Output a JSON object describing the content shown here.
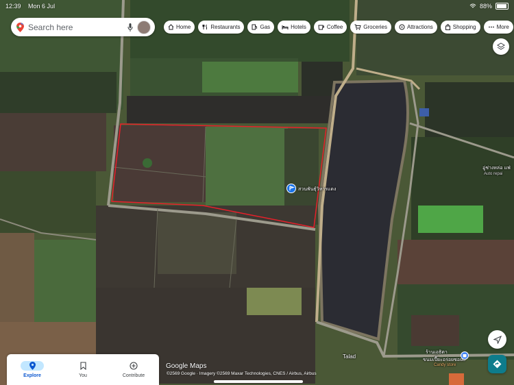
{
  "status_bar": {
    "time": "12:39",
    "date": "Mon 6 Jul",
    "battery": "88%"
  },
  "search": {
    "placeholder": "Search here"
  },
  "chips": [
    {
      "label": "Home",
      "icon": "home-icon"
    },
    {
      "label": "Restaurants",
      "icon": "fork-knife-icon"
    },
    {
      "label": "Gas",
      "icon": "gas-pump-icon"
    },
    {
      "label": "Hotels",
      "icon": "bed-icon"
    },
    {
      "label": "Coffee",
      "icon": "coffee-cup-icon"
    },
    {
      "label": "Groceries",
      "icon": "cart-icon"
    },
    {
      "label": "Attractions",
      "icon": "attraction-icon"
    },
    {
      "label": "Shopping",
      "icon": "shopping-bag-icon"
    },
    {
      "label": "More",
      "icon": "more-dots-icon"
    }
  ],
  "map": {
    "place_label": "สวนพันธุ์วิหารแดง",
    "poi_label_1": "อู่ช่างหล่อ แฟ่",
    "poi_label_1_sub": "Auto repai",
    "road_label": "Talad",
    "poi_label_2": "ร้านเอธิตา",
    "poi_label_2_line2": "ขนมเปี๊ยะอร่อยซอย8",
    "poi_label_2_sub": "Candy store",
    "accent_red": "#e8202a"
  },
  "attribution": {
    "logo": "Google Maps",
    "copyright": "©2569 Google · Imagery ©2569 Maxar Technologies, CNES / Airbus, Airbus"
  },
  "tabs": [
    {
      "label": "Explore",
      "active": true
    },
    {
      "label": "You",
      "active": false
    },
    {
      "label": "Contribute",
      "active": false
    }
  ]
}
